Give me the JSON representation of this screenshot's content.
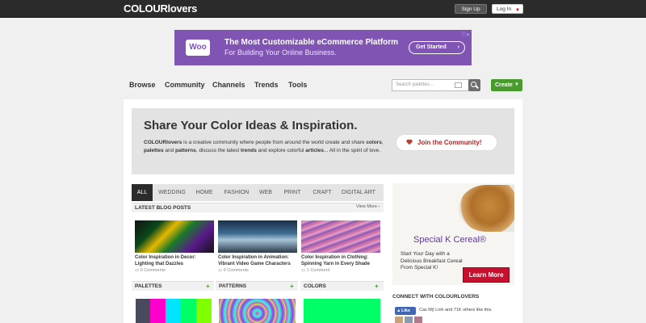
{
  "topbar": {
    "logo": "COLOURlovers",
    "signup_label": "Sign Up",
    "login_label": "Log In"
  },
  "ad": {
    "logo": "Woo",
    "title": "The Most Customizable eCommerce Platform",
    "subtitle": "For Building Your Online Business.",
    "cta": "Get Started"
  },
  "nav": {
    "items": [
      "Browse",
      "Community",
      "Channels",
      "Trends",
      "Tools"
    ],
    "search_placeholder": "Search palettes...",
    "create_label": "Create"
  },
  "hero": {
    "title": "Share Your Color Ideas & Inspiration.",
    "brand": "COLOURlovers",
    "text1": " is a creative community where people from around the world create and share ",
    "colors": "colors",
    "palettes": "palettes",
    "and_text": " and ",
    "patterns": "patterns",
    "text2": ", discuss the latest ",
    "trends": "trends",
    "text3": " and explore colorful ",
    "articles": "articles",
    "text4": "... All in the spirit of love.",
    "join_label": "Join the Community!"
  },
  "tabs": [
    "ALL",
    "WEDDING",
    "HOME",
    "FASHION",
    "WEB",
    "PRINT",
    "CRAFT",
    "DIGITAL ART"
  ],
  "blog": {
    "header": "LATEST BLOG POSTS",
    "view_more": "View More ›",
    "posts": [
      {
        "title": "Color Inspiration in Decor: Lighting that Dazzles",
        "meta": "0 Comments"
      },
      {
        "title": "Color Inspiration in Animation: Vibrant Video Game Characters",
        "meta": "0 Comments"
      },
      {
        "title": "Color Inspiration in Clothing: Spinning Yarn in Every Shade",
        "meta": "1 Comment"
      }
    ]
  },
  "sections": {
    "palettes": "PALETTES",
    "patterns": "PATTERNS",
    "colors": "COLORS",
    "plus": "+"
  },
  "side_ad": {
    "title": "Special K Cereal®",
    "text": "Start Your Day with a Delicious Breakfast Cereal From Special K!",
    "cta": "Learn More"
  },
  "connect": {
    "title": "CONNECT WITH COLOURLOVERS",
    "like_label": "Like",
    "like_text": "Cas Mỹ Linh and 71K others like this."
  },
  "colors": {
    "topbar": "#2b2b2b",
    "ad_purple": "#7f54b3",
    "create_green": "#4a9b2f",
    "join_red": "#b22222",
    "palette_swatches": [
      "#4a4a5e",
      "#ff00cc",
      "#00e5ff",
      "#00ff66",
      "#80ff00"
    ],
    "color_swatch": "#00ff66"
  }
}
